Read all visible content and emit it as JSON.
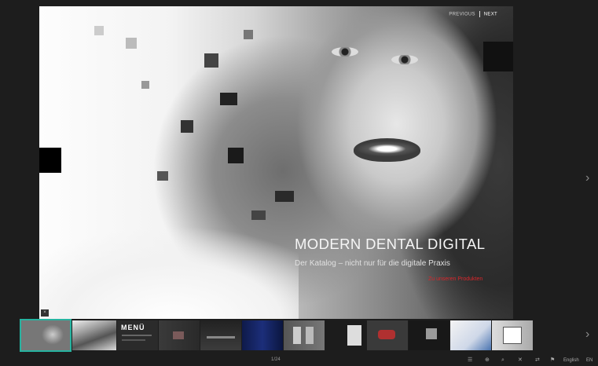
{
  "nav": {
    "previous": "PREVIOUS",
    "next": "NEXT"
  },
  "cover": {
    "title": "MODERN DENTAL DIGITAL",
    "subtitle": "Der Katalog – nicht nur für die digitale Praxis",
    "highlight": "Zu unseren Produkten"
  },
  "close_label": "×",
  "thumbnail_text": {
    "menu": "MENÜ"
  },
  "footer": {
    "page_indicator": "1/24",
    "language": "English",
    "extra": "EN"
  },
  "colors": {
    "accent": "#27b3a0",
    "red": "#d8262b",
    "background": "#1b1b1b"
  },
  "icons": [
    "toc-icon",
    "zoom-in-icon",
    "search-icon",
    "fullscreen-icon",
    "share-icon",
    "download-icon",
    "language-icon"
  ]
}
